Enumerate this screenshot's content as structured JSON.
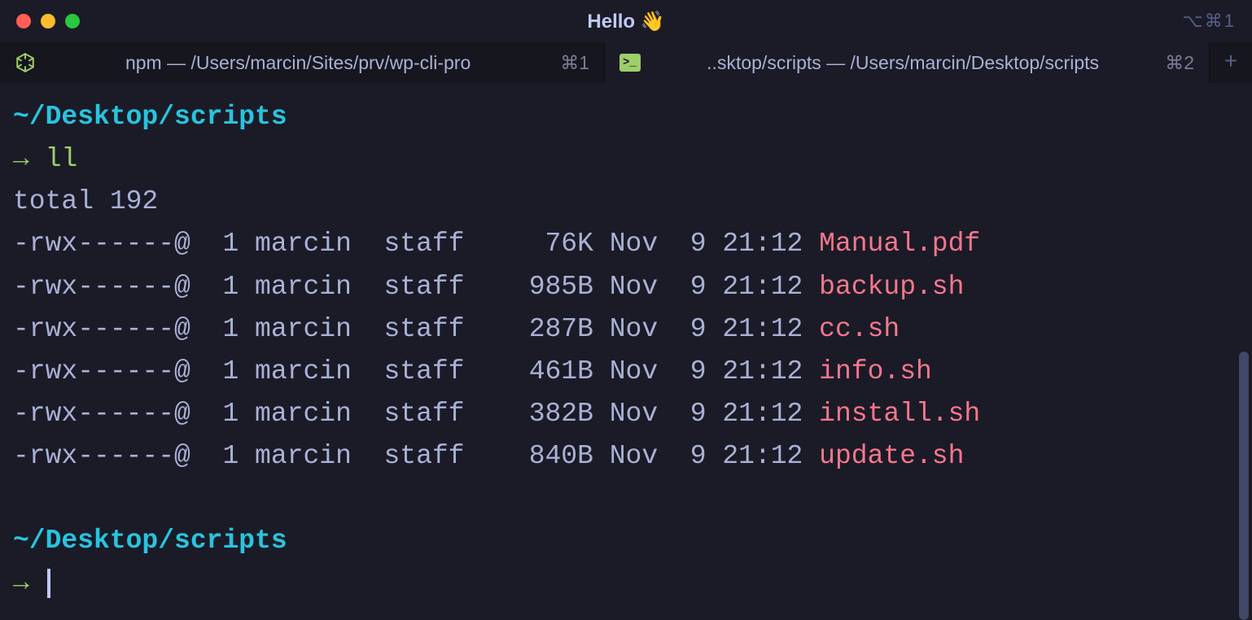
{
  "window": {
    "title": "Hello 👋",
    "shortcut_hint": "⌥⌘1"
  },
  "tabs": [
    {
      "icon": "nodejs-icon",
      "title": "npm — /Users/marcin/Sites/prv/wp-cli-pro",
      "shortcut": "⌘1",
      "active": false
    },
    {
      "icon": "terminal-icon",
      "title": "..sktop/scripts — /Users/marcin/Desktop/scripts",
      "shortcut": "⌘2",
      "active": true
    }
  ],
  "terminal": {
    "cwd": "~/Desktop/scripts",
    "prompt_arrow": "→",
    "command": "ll",
    "total_line": "total 192",
    "files": [
      {
        "perms": "-rwx------@",
        "links": "1",
        "owner": "marcin",
        "group": "staff",
        "size": " 76K",
        "date": "Nov  9 21:12",
        "name": "Manual.pdf"
      },
      {
        "perms": "-rwx------@",
        "links": "1",
        "owner": "marcin",
        "group": "staff",
        "size": "985B",
        "date": "Nov  9 21:12",
        "name": "backup.sh"
      },
      {
        "perms": "-rwx------@",
        "links": "1",
        "owner": "marcin",
        "group": "staff",
        "size": "287B",
        "date": "Nov  9 21:12",
        "name": "cc.sh"
      },
      {
        "perms": "-rwx------@",
        "links": "1",
        "owner": "marcin",
        "group": "staff",
        "size": "461B",
        "date": "Nov  9 21:12",
        "name": "info.sh"
      },
      {
        "perms": "-rwx------@",
        "links": "1",
        "owner": "marcin",
        "group": "staff",
        "size": "382B",
        "date": "Nov  9 21:12",
        "name": "install.sh"
      },
      {
        "perms": "-rwx------@",
        "links": "1",
        "owner": "marcin",
        "group": "staff",
        "size": "840B",
        "date": "Nov  9 21:12",
        "name": "update.sh"
      }
    ],
    "cwd2": "~/Desktop/scripts"
  }
}
